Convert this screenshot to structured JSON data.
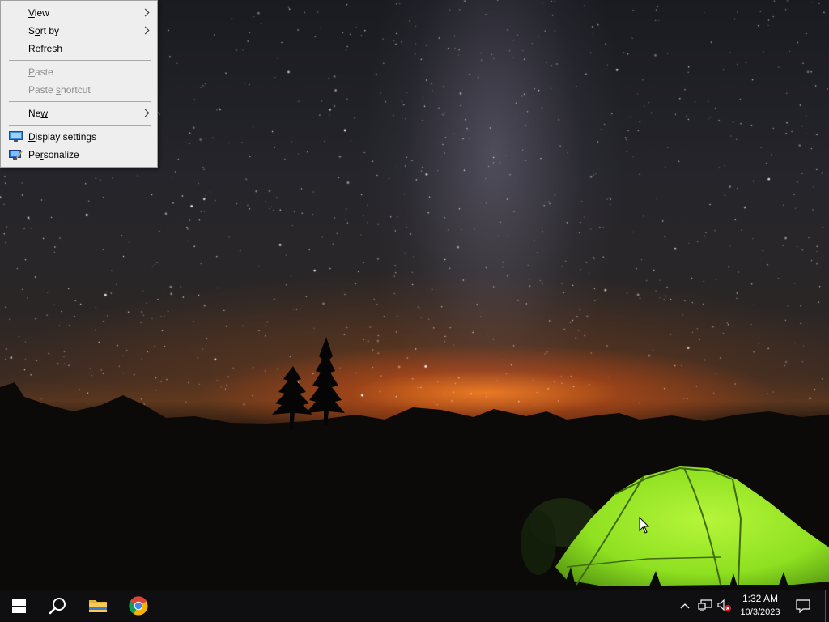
{
  "context_menu": {
    "items": [
      {
        "label": "View",
        "submenu": true,
        "enabled": true
      },
      {
        "label": "Sort by",
        "submenu": true,
        "enabled": true
      },
      {
        "label": "Refresh",
        "submenu": false,
        "enabled": true
      },
      {
        "label": "Paste",
        "submenu": false,
        "enabled": false
      },
      {
        "label": "Paste shortcut",
        "submenu": false,
        "enabled": false
      },
      {
        "label": "New",
        "submenu": true,
        "enabled": true
      },
      {
        "label": "Display settings",
        "icon": "display-settings-icon",
        "enabled": true
      },
      {
        "label": "Personalize",
        "icon": "personalize-icon",
        "enabled": true
      }
    ]
  },
  "taskbar": {
    "pinned": [
      {
        "name": "start",
        "icon": "windows-logo-icon"
      },
      {
        "name": "search",
        "icon": "search-icon"
      },
      {
        "name": "file-explorer",
        "icon": "folder-icon"
      },
      {
        "name": "google-chrome",
        "icon": "chrome-icon"
      }
    ],
    "tray_icons": [
      "chevron-up-icon",
      "network-icon",
      "volume-muted-icon"
    ],
    "clock": {
      "time": "1:32 AM",
      "date": "10/3/2023"
    },
    "action_center_icon": "notification-icon"
  },
  "colors": {
    "taskbar_bg": "#0f0f12",
    "menu_bg": "#eeeeee",
    "tent_green": "#8ee020",
    "horizon_glow": "#ff7a1a"
  }
}
